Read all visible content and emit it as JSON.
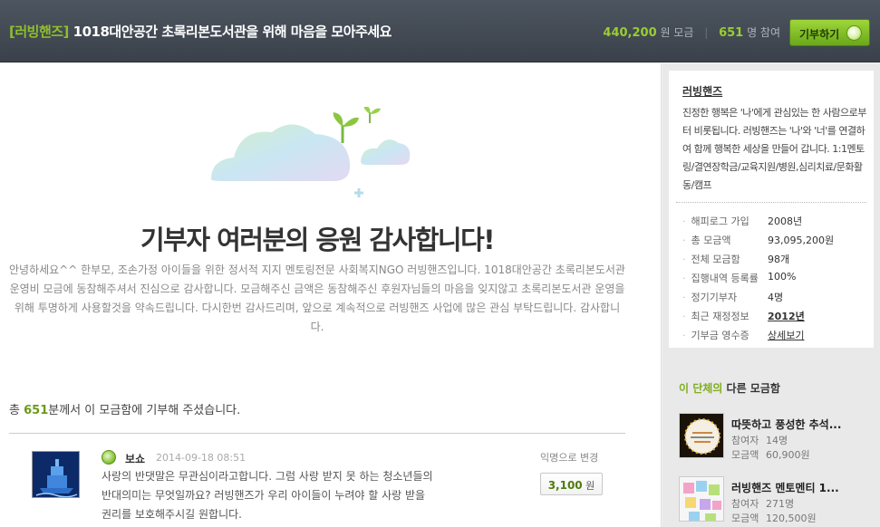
{
  "header": {
    "org_tag": "[러빙핸즈]",
    "title": "1018대안공간 초록리본도서관을 위해 마음을 모아주세요",
    "amount": "440,200",
    "amount_unit": "원 모금",
    "participants": "651",
    "participants_unit": "명 참여",
    "donate_label": "기부하기"
  },
  "main": {
    "headline": "기부자 여러분의 응원 감사합니다!",
    "intro": "안녕하세요^^ 한부모, 조손가정 아이들을 위한 정서적 지지 멘토링전문 사회복지NGO 러빙핸즈입니다. 1018대안공간 초록리본도서관 운영비 모금에 동참해주셔서 진심으로 감사합니다. 모금해주신 금액은 동참해주신 후원자님들의 마음을 잊지않고 초록리본도서관 운영을 위해 투명하게 사용할것을 약속드립니다. 다시한번 감사드리며, 앞으로 계속적으로 러빙핸즈 사업에 많은 관심 부탁드립니다. 감사합니다.",
    "count_prefix": "총",
    "count_value": "651",
    "count_suffix": "분께서 이 모금함에 기부해 주셨습니다."
  },
  "comment": {
    "name": "보쇼",
    "date": "2014-09-18 08:51",
    "text": "사랑의 반댓말은 무관심이라고합니다. 그럼 사랑 받지 못 하는 청소년들의 반대의미는 무엇일까요? 러빙핸즈가 우리 아이들이 누려야 할 사랑 받을 권리를 보호해주시길 원합니다.",
    "anon_label": "익명으로 변경",
    "amount": "3,100",
    "amount_unit": "원"
  },
  "sidebar": {
    "org_name": "러빙핸즈",
    "description": "진정한 행복은 '나'에게 관심있는 한 사람으로부터 비롯됩니다. 러빙핸즈는 '나'와 '너'를 연결하여 함께 행복한 세상을 만들어 갑니다. 1:1멘토링/결연장학금/교육지원/병원,심리치료/문화활동/캠프",
    "info": [
      {
        "k": "해피로그 가입",
        "v": "2008년"
      },
      {
        "k": "총 모금액",
        "v": "93,095,200원"
      },
      {
        "k": "전체 모금함",
        "v": "98개"
      },
      {
        "k": "집행내역 등록률",
        "v": "100%"
      },
      {
        "k": "정기기부자",
        "v": "4명"
      },
      {
        "k": "최근 재정정보",
        "v": "2012년"
      },
      {
        "k": "기부금 영수증",
        "v": "상세보기"
      }
    ],
    "other_title_accent": "이 단체의",
    "other_title_rest": "다른 모금함",
    "funds": [
      {
        "title": "따뜻하고 풍성한 추석...",
        "participants_label": "참여자",
        "participants": "14명",
        "amount_label": "모금액",
        "amount": "60,900원"
      },
      {
        "title": "러빙핸즈 멘토멘티 1...",
        "participants_label": "참여자",
        "participants": "271명",
        "amount_label": "모금액",
        "amount": "120,500원"
      }
    ]
  },
  "colors": {
    "accent_green": "#9acd32",
    "topbar": "#434a53"
  }
}
